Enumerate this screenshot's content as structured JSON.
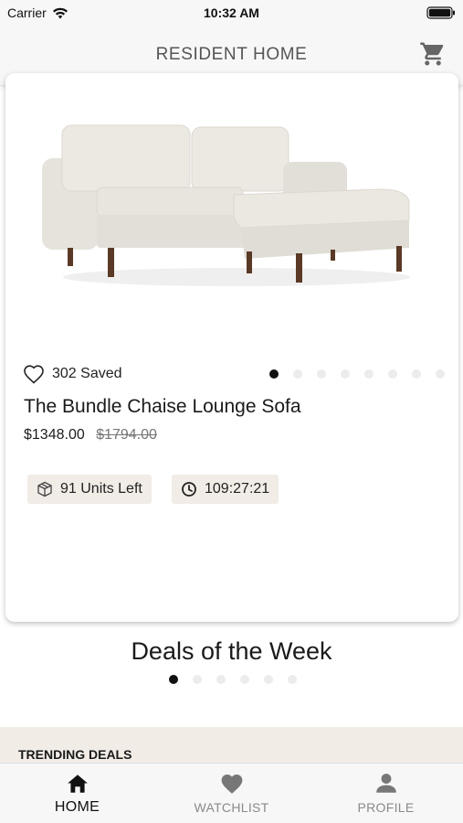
{
  "status_bar": {
    "carrier": "Carrier",
    "time": "10:32 AM"
  },
  "nav": {
    "title": "RESIDENT HOME",
    "cart_icon": "cart-icon"
  },
  "product": {
    "saved_count": "302 Saved",
    "name": "The Bundle Chaise Lounge Sofa",
    "price": "$1348.00",
    "original_price": "$1794.00",
    "units_left": "91 Units Left",
    "countdown": "109:27:21",
    "image_dots": {
      "total": 8,
      "active": 0
    }
  },
  "deals": {
    "title": "Deals of the Week",
    "dots": {
      "total": 6,
      "active": 0
    }
  },
  "trending": {
    "label": "TRENDING DEALS"
  },
  "tabs": [
    {
      "label": "HOME",
      "icon": "home-icon",
      "active": true
    },
    {
      "label": "WATCHLIST",
      "icon": "heart-icon",
      "active": false
    },
    {
      "label": "PROFILE",
      "icon": "person-icon",
      "active": false
    }
  ],
  "colors": {
    "chip_bg": "#f1ece6",
    "bar_bg": "#f7f7f7",
    "accent_dark": "#111111"
  }
}
